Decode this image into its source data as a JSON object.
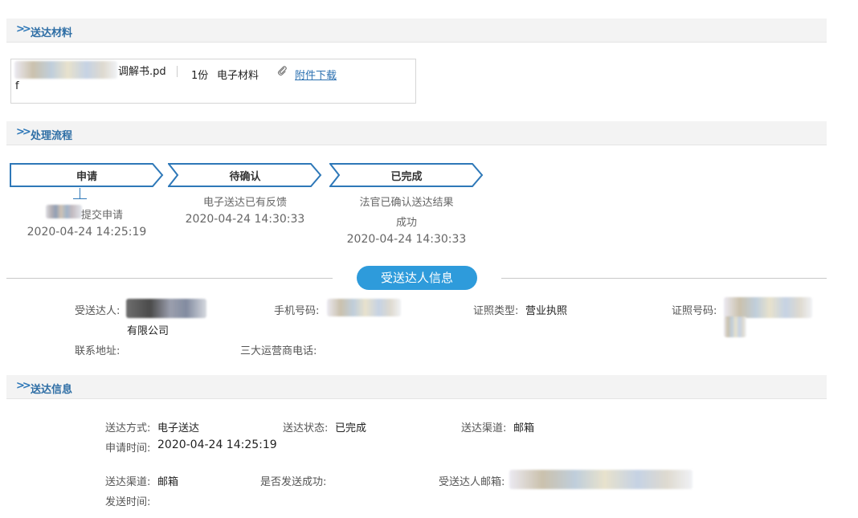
{
  "sections": {
    "materials": "送达材料",
    "process": "处理流程",
    "recipient_info": "受送达人信息",
    "delivery_info": "送达信息"
  },
  "chevron": "»",
  "attachment": {
    "filename_tail": "调解书.pd",
    "filename_wrap": "f",
    "copies": "1份",
    "type": "电子材料",
    "download": "附件下载"
  },
  "steps": [
    {
      "label": "申请",
      "lines": [
        "提交申请"
      ],
      "time": "2020-04-24 14:25:19"
    },
    {
      "label": "待确认",
      "lines": [
        "电子送达已有反馈"
      ],
      "time": "2020-04-24 14:30:33"
    },
    {
      "label": "已完成",
      "lines": [
        "法官已确认送达结果",
        "成功"
      ],
      "time": "2020-04-24 14:30:33"
    }
  ],
  "recipient": {
    "name_label": "受送达人:",
    "name_tail": "有限公司",
    "phone_label": "手机号码:",
    "id_type_label": "证照类型:",
    "id_type_value": "营业执照",
    "id_number_label": "证照号码:",
    "address_label": "联系地址:",
    "carrier_phone_label": "三大运营商电话:"
  },
  "delivery": {
    "method_label": "送达方式:",
    "method_value": "电子送达",
    "status_label": "送达状态:",
    "status_value": "已完成",
    "channel_label": "送达渠道:",
    "channel_value": "邮箱",
    "apply_time_label": "申请时间:",
    "apply_time_value": "2020-04-24 14:25:19",
    "channel2_label": "送达渠道:",
    "channel2_value": "邮箱",
    "success_label": "是否发送成功:",
    "email_label": "受送达人邮箱:",
    "send_time_label": "发送时间:"
  },
  "colors": {
    "accent": "#2e9bdb",
    "step_border": "#2e78b8",
    "header_text": "#2e6ea5"
  },
  "icons": [
    "chevron-double-right-icon",
    "paperclip-icon"
  ]
}
